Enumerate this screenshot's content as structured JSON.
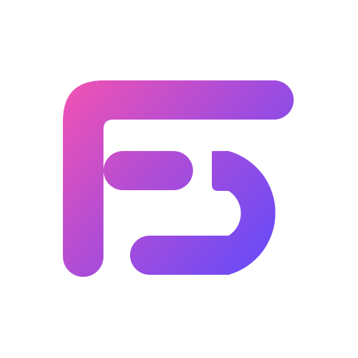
{
  "logo": {
    "icon": "fs-monogram-logo",
    "colors": {
      "gradient_start": "#F052B4",
      "gradient_mid": "#A44CDC",
      "gradient_end": "#5A4BFF",
      "background": "#FFFFFF"
    }
  }
}
